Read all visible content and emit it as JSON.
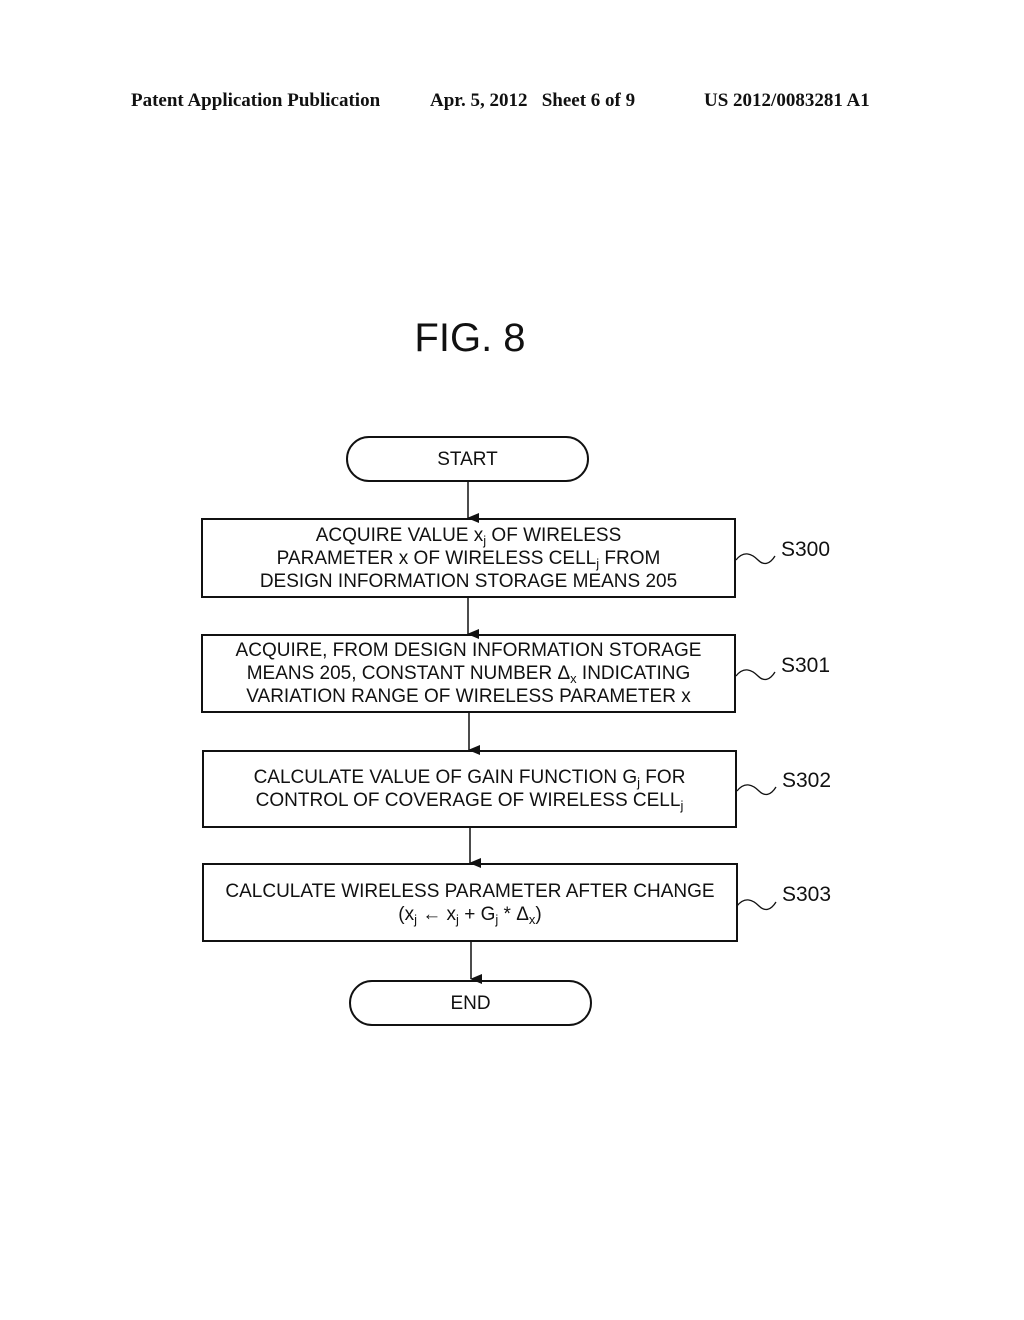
{
  "header": {
    "publication": "Patent Application Publication",
    "date_sheet": "Apr. 5, 2012   Sheet 6 of 9",
    "patent_number": "US 2012/0083281 A1"
  },
  "figure": {
    "title": "FIG. 8"
  },
  "flowchart": {
    "start": "START",
    "end": "END",
    "steps": [
      {
        "id": "S300",
        "lines": [
          [
            "ACQUIRE VALUE x",
            "j",
            " OF WIRELESS"
          ],
          [
            "PARAMETER x OF WIRELESS CELL",
            "j",
            " FROM"
          ],
          [
            "DESIGN INFORMATION STORAGE MEANS 205",
            "",
            ""
          ]
        ]
      },
      {
        "id": "S301",
        "lines": [
          [
            "ACQUIRE, FROM DESIGN INFORMATION STORAGE",
            "",
            ""
          ],
          [
            "MEANS 205, CONSTANT NUMBER Δ",
            "x",
            " INDICATING"
          ],
          [
            "VARIATION RANGE OF WIRELESS PARAMETER x",
            "",
            ""
          ]
        ]
      },
      {
        "id": "S302",
        "lines": [
          [
            "CALCULATE VALUE OF GAIN FUNCTION G",
            "j",
            " FOR"
          ],
          [
            "CONTROL OF COVERAGE OF WIRELESS CELL",
            "j",
            ""
          ]
        ]
      },
      {
        "id": "S303",
        "lines": [
          [
            "CALCULATE WIRELESS PARAMETER AFTER CHANGE",
            "",
            ""
          ],
          [
            "(x",
            "j",
            " ← x"
          ],
          [
            "",
            "j",
            " + G"
          ],
          [
            "",
            "j",
            " * Δ"
          ],
          [
            "",
            "x",
            ")"
          ]
        ]
      }
    ]
  }
}
